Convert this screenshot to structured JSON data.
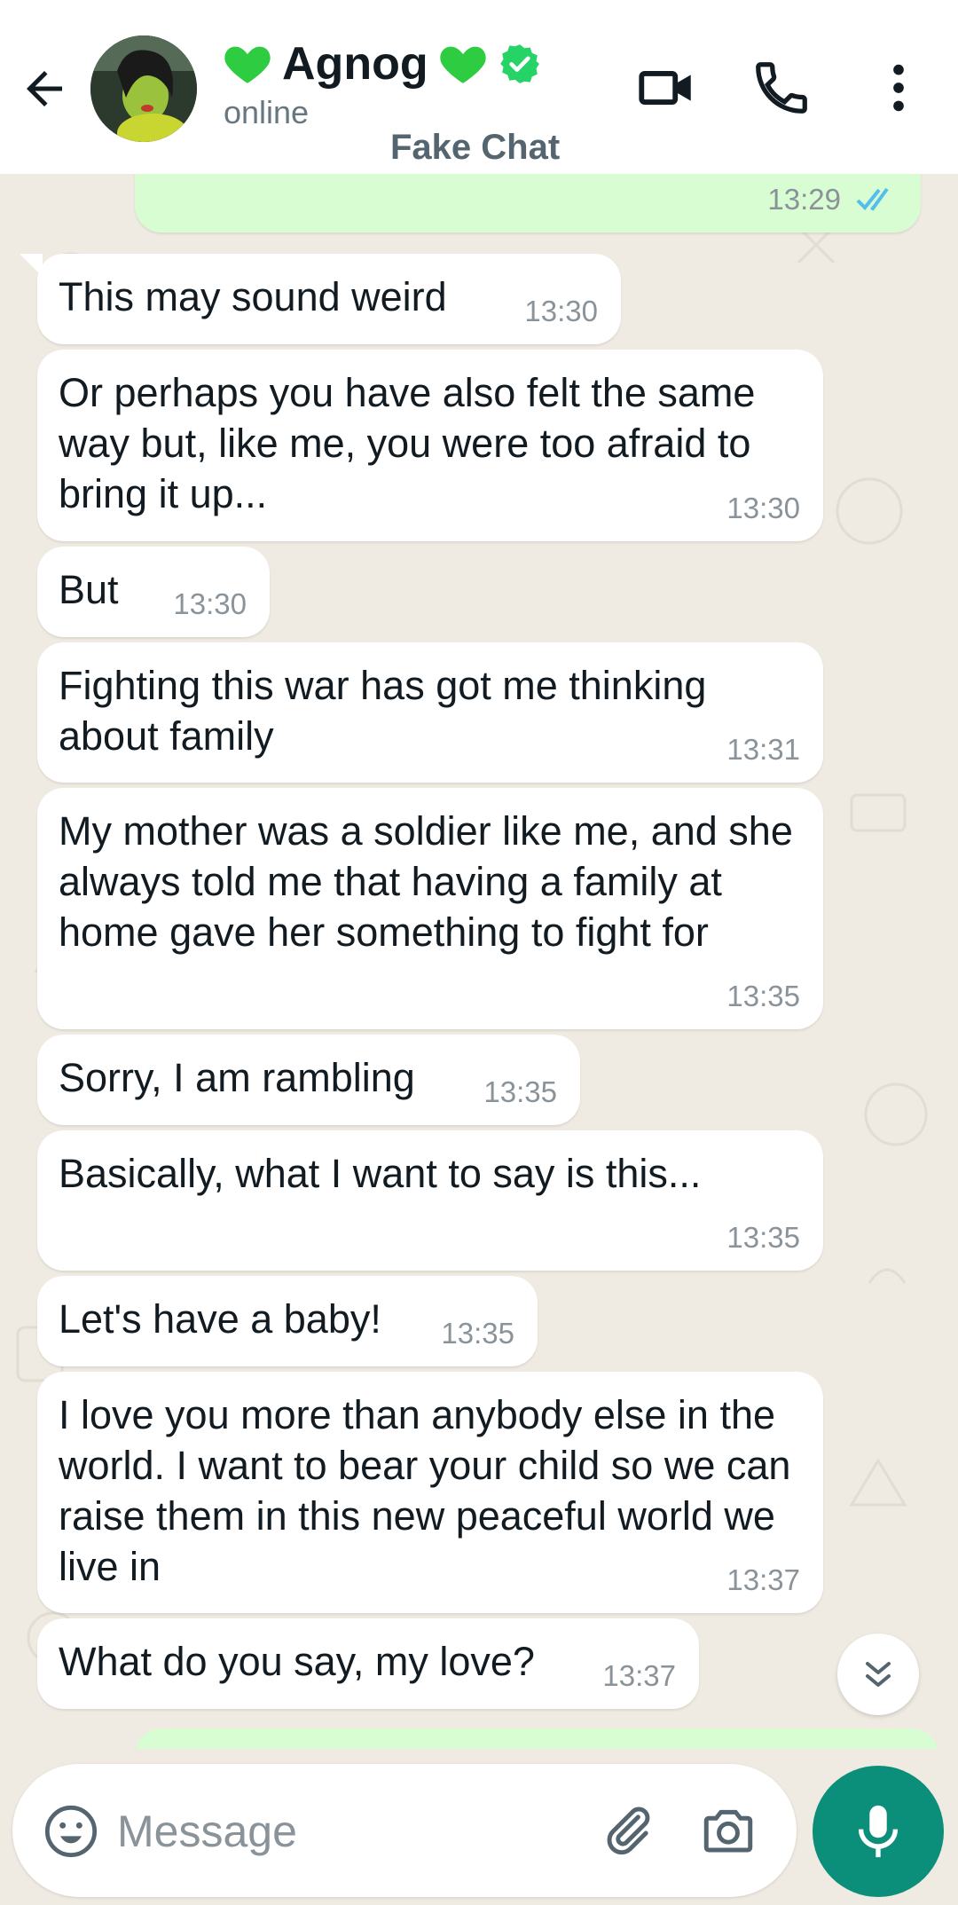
{
  "header": {
    "contact_name": "Agnog",
    "status": "online",
    "watermark": "Fake Chat",
    "heart_icon_color": "#2ecc40",
    "verified_color": "#25d366"
  },
  "messages": {
    "outgoing_top_time": "13:29",
    "incoming": [
      {
        "text": "This may sound weird",
        "time": "13:30"
      },
      {
        "text": "Or perhaps you have also felt the same way but, like me, you were too afraid to bring it up...",
        "time": "13:30"
      },
      {
        "text": "But",
        "time": "13:30"
      },
      {
        "text": "Fighting this war has got me thinking about family",
        "time": "13:31"
      },
      {
        "text": "My mother was a soldier like me, and she always told me that having a family at home gave her something to fight for",
        "time": "13:35"
      },
      {
        "text": "Sorry, I am rambling",
        "time": "13:35"
      },
      {
        "text": "Basically, what I want to say is this...",
        "time": "13:35"
      },
      {
        "text": "Let's have a baby!",
        "time": "13:35"
      },
      {
        "text": "I love you more than anybody else in the world. I want to bear your child so we can raise them in this new peaceful world we live in",
        "time": "13:37"
      },
      {
        "text": "What do you say, my love?",
        "time": "13:37"
      }
    ]
  },
  "composer": {
    "placeholder": "Message"
  },
  "colors": {
    "accent": "#0b8f7a",
    "outgoing_bubble": "#d9fdd3",
    "incoming_bubble": "#ffffff",
    "chat_background": "#efeae2",
    "read_ticks": "#53bdeb"
  }
}
